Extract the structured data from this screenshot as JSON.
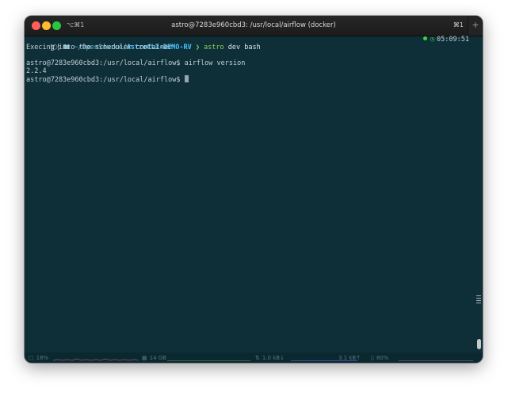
{
  "window": {
    "tab_shortcut": "⌥⌘1",
    "title": "astro@7283e960cbd3: /usr/local/airflow (docker)",
    "right_shortcut": "⌘1",
    "new_tab": "+"
  },
  "terminal": {
    "prompt": {
      "tag": "🍽",
      "icon": "🖿",
      "path_prefix": "~/OpenSource/",
      "path_bold": "AstroCLI-DEMO-RV",
      "chevron": "❯",
      "command": "astro",
      "args": "dev bash"
    },
    "right_status": {
      "time": "05:09:51"
    },
    "lines": [
      "Execing into the scheduler container",
      "",
      "astro@7283e960cbd3:/usr/local/airflow$ airflow version",
      "2.2.4",
      "astro@7283e960cbd3:/usr/local/airflow$ "
    ]
  },
  "statusbar": {
    "cpu": "18%",
    "memory": "14 GB",
    "net_down": "1.0 kB↓",
    "net_up": "3.1 kB↑",
    "battery": "80%"
  },
  "colors": {
    "background": "#0e2f38",
    "path": "#47c1ff",
    "command": "#8fd14f"
  }
}
